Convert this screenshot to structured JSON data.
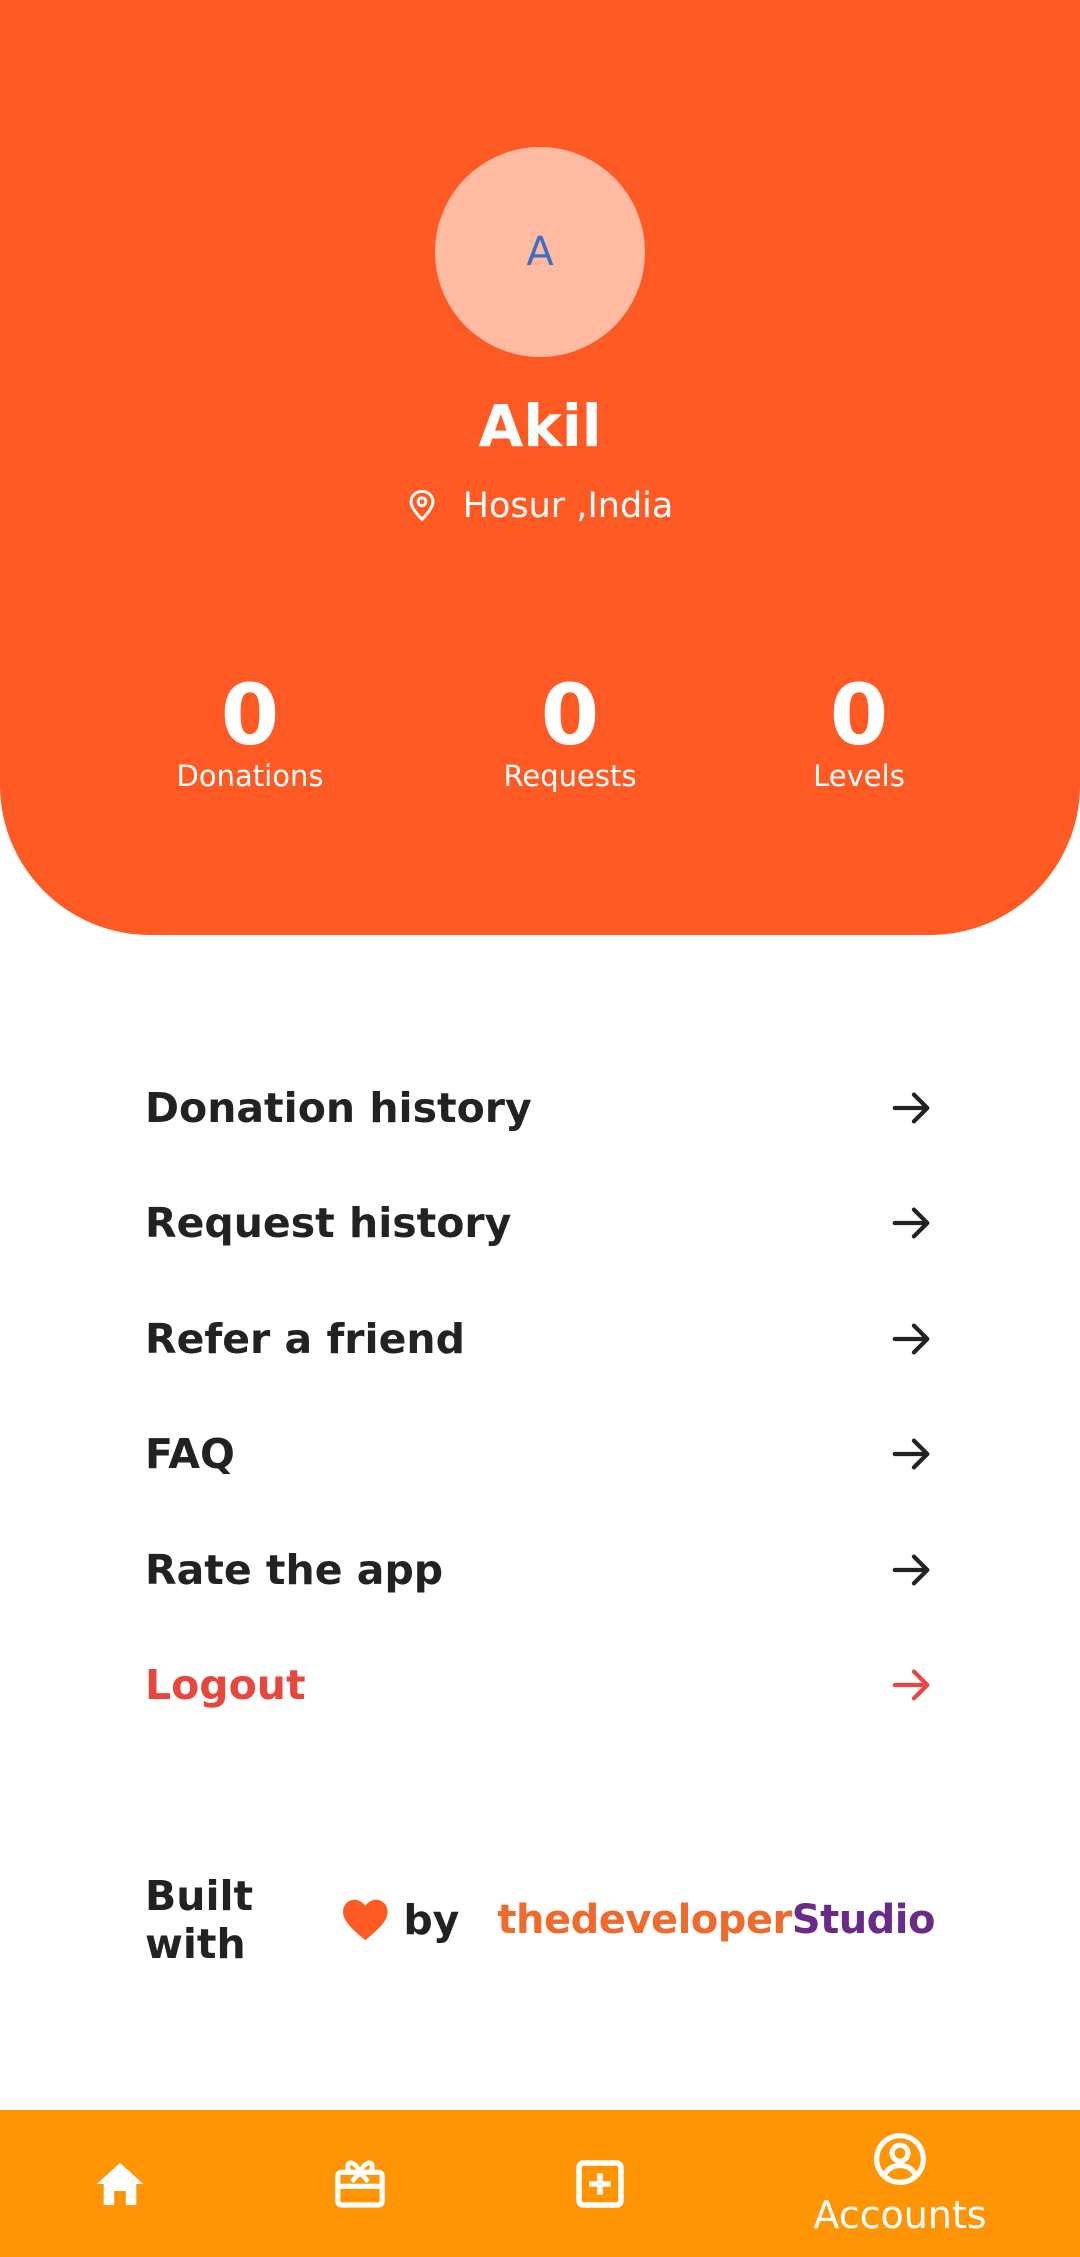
{
  "profile": {
    "avatar_initial": "A",
    "name": "Akil",
    "location": "Hosur ,India"
  },
  "stats": [
    {
      "value": "0",
      "label": "Donations"
    },
    {
      "value": "0",
      "label": "Requests"
    },
    {
      "value": "0",
      "label": "Levels"
    }
  ],
  "menu": {
    "items": [
      {
        "label": "Donation history"
      },
      {
        "label": "Request history"
      },
      {
        "label": "Refer a friend"
      },
      {
        "label": "FAQ"
      },
      {
        "label": "Rate the app"
      },
      {
        "label": "Logout"
      }
    ]
  },
  "footer": {
    "built_with": "Built with",
    "by": "by",
    "brand_part1": "thedeveloper",
    "brand_part2": "Studio"
  },
  "bottom_nav": {
    "items": [
      {
        "icon": "home-icon"
      },
      {
        "icon": "gift-card-icon"
      },
      {
        "icon": "add-box-icon"
      },
      {
        "icon": "account-circle-icon",
        "label": "Accounts"
      }
    ]
  },
  "colors": {
    "header": "#ff5a24",
    "bottom_nav": "#ff9504",
    "logout": "#e8473f",
    "heart": "#ff5a24"
  }
}
